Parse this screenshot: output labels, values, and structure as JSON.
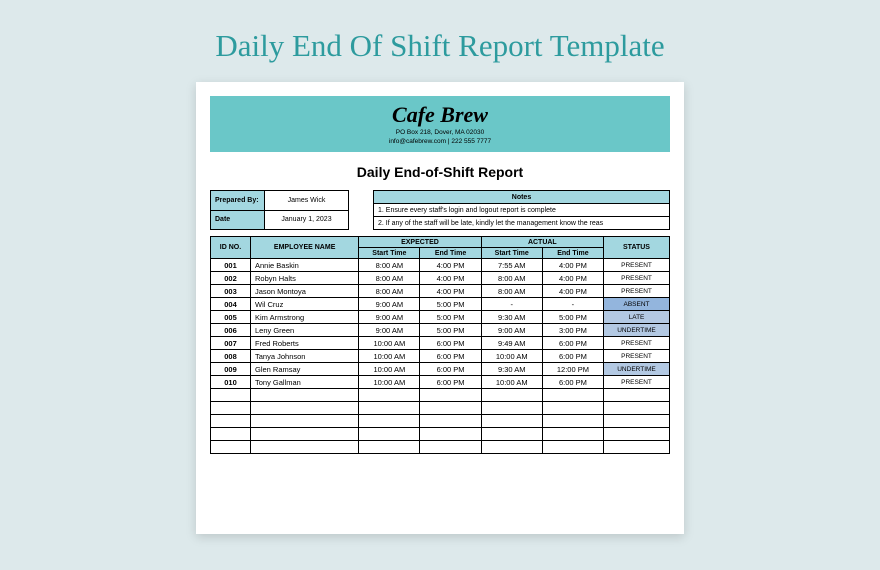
{
  "pageTitle": "Daily End Of Shift Report Template",
  "header": {
    "brand": "Cafe Brew",
    "address": "PO Box 218, Dover, MA 02030",
    "contact": "info@cafebrew.com | 222 555 7777"
  },
  "reportTitle": "Daily End-of-Shift Report",
  "meta": {
    "preparedByLabel": "Prepared By:",
    "preparedBy": "James Wick",
    "dateLabel": "Date",
    "date": "January 1, 2023"
  },
  "notes": {
    "header": "Notes",
    "line1": "1. Ensure every staff's login and logout report is complete",
    "line2": "2. If any of the staff will be late, kindly let the management know the reas"
  },
  "columns": {
    "id": "ID NO.",
    "name": "EMPLOYEE NAME",
    "expected": "EXPECTED",
    "actual": "ACTUAL",
    "start": "Start Time",
    "end": "End Time",
    "status": "STATUS"
  },
  "rows": [
    {
      "id": "001",
      "name": "Annie Baskin",
      "expStart": "8:00 AM",
      "expEnd": "4:00 PM",
      "actStart": "7:55 AM",
      "actEnd": "4:00 PM",
      "status": "PRESENT",
      "statusClass": "status-present"
    },
    {
      "id": "002",
      "name": "Robyn Halts",
      "expStart": "8:00 AM",
      "expEnd": "4:00 PM",
      "actStart": "8:00 AM",
      "actEnd": "4:00 PM",
      "status": "PRESENT",
      "statusClass": "status-present"
    },
    {
      "id": "003",
      "name": "Jason Montoya",
      "expStart": "8:00 AM",
      "expEnd": "4:00 PM",
      "actStart": "8:00 AM",
      "actEnd": "4:00 PM",
      "status": "PRESENT",
      "statusClass": "status-present"
    },
    {
      "id": "004",
      "name": "Wil Cruz",
      "expStart": "9:00 AM",
      "expEnd": "5:00 PM",
      "actStart": "-",
      "actEnd": "-",
      "status": "ABSENT",
      "statusClass": "status-absent"
    },
    {
      "id": "005",
      "name": "Kim Armstrong",
      "expStart": "9:00 AM",
      "expEnd": "5:00 PM",
      "actStart": "9:30 AM",
      "actEnd": "5:00 PM",
      "status": "LATE",
      "statusClass": "status-late"
    },
    {
      "id": "006",
      "name": "Leny Green",
      "expStart": "9:00 AM",
      "expEnd": "5:00 PM",
      "actStart": "9:00 AM",
      "actEnd": "3:00 PM",
      "status": "UNDERTIME",
      "statusClass": "status-undertime"
    },
    {
      "id": "007",
      "name": "Fred Roberts",
      "expStart": "10:00 AM",
      "expEnd": "6:00 PM",
      "actStart": "9:49 AM",
      "actEnd": "6:00 PM",
      "status": "PRESENT",
      "statusClass": "status-present"
    },
    {
      "id": "008",
      "name": "Tanya Johnson",
      "expStart": "10:00 AM",
      "expEnd": "6:00 PM",
      "actStart": "10:00 AM",
      "actEnd": "6:00 PM",
      "status": "PRESENT",
      "statusClass": "status-present"
    },
    {
      "id": "009",
      "name": "Glen Ramsay",
      "expStart": "10:00 AM",
      "expEnd": "6:00 PM",
      "actStart": "9:30 AM",
      "actEnd": "12:00 PM",
      "status": "UNDERTIME",
      "statusClass": "status-undertime"
    },
    {
      "id": "010",
      "name": "Tony Gallman",
      "expStart": "10:00 AM",
      "expEnd": "6:00 PM",
      "actStart": "10:00 AM",
      "actEnd": "6:00 PM",
      "status": "PRESENT",
      "statusClass": "status-present"
    }
  ],
  "emptyRows": 5
}
